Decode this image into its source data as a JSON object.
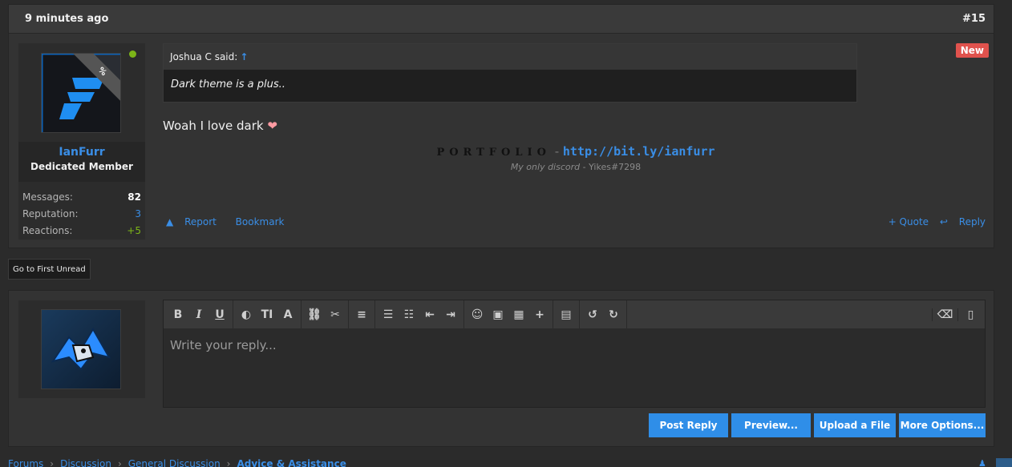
{
  "post": {
    "time": "9 minutes ago",
    "number": "#15",
    "badge": "New",
    "ribbon": "%",
    "user": {
      "name": "IanFurr",
      "title": "Dedicated Member",
      "stats": [
        {
          "label": "Messages:",
          "value": "82",
          "color": "#ffffff"
        },
        {
          "label": "Reputation:",
          "value": "3",
          "color": "#3a8ee6"
        },
        {
          "label": "Reactions:",
          "value": "+5",
          "color": "#7cb518"
        }
      ]
    },
    "quote": {
      "author": "Joshua C said:",
      "arrow": "↑",
      "text": "Dark theme is a plus.."
    },
    "message": "Woah I love dark",
    "heart": "❤",
    "signature": {
      "portfolio": "PORTFOLIO",
      "dash": "-",
      "link": "http://bit.ly/ianfurr",
      "discord_label": "My only discord",
      "discord_value": "- Yikes#7298"
    },
    "actions": {
      "report": "Report",
      "bookmark": "Bookmark",
      "quote": "+ Quote",
      "reply": "Reply"
    }
  },
  "go_first_unread": "Go to First Unread",
  "editor": {
    "placeholder": "Write your reply...",
    "buttons": {
      "post_reply": "Post Reply",
      "preview": "Preview...",
      "upload": "Upload a File",
      "more": "More Options..."
    }
  },
  "breadcrumbs": [
    "Forums",
    "Discussion",
    "General Discussion",
    "Advice & Assistance"
  ],
  "breadcrumb_sep": "›",
  "colors": {
    "accent": "#3a8ee6",
    "button": "#2f8ee8",
    "new_badge": "#e0524d",
    "online": "#7cb518"
  }
}
